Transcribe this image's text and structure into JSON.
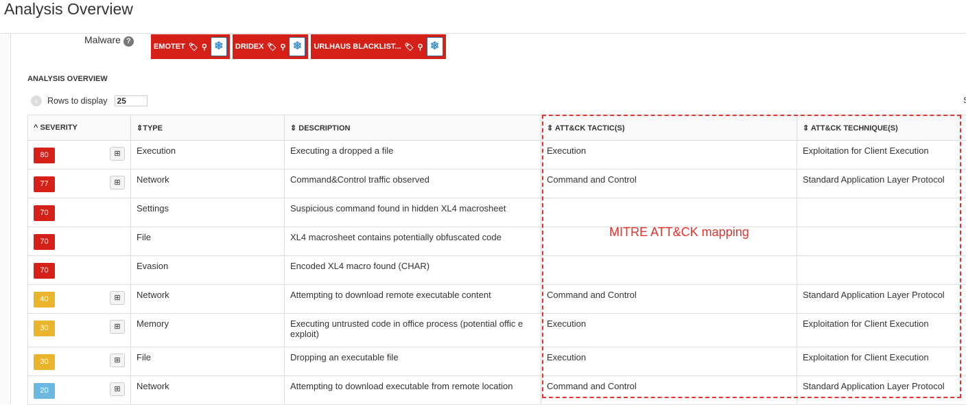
{
  "header": {
    "title": "Analysis Overview"
  },
  "malware": {
    "label": "Malware",
    "help": "?",
    "tags": [
      {
        "name": "EMOTET"
      },
      {
        "name": "DRIDEX"
      },
      {
        "name": "URLHAUS BLACKLIST..."
      }
    ]
  },
  "section_title": "ANALYSIS OVERVIEW",
  "rows_to_display": {
    "label": "Rows to display",
    "value": "25",
    "right_text": "S"
  },
  "columns": [
    "SEVERITY",
    "TYPE",
    "DESCRIPTION",
    "ATT&CK TACTIC(S)",
    "ATT&CK TECHNIQUE(S)"
  ],
  "rows": [
    {
      "score": "80",
      "color": "#d42017",
      "os": true,
      "type": "Execution",
      "desc": "Executing a dropped a file",
      "tactic": "Execution",
      "tech": "Exploitation for Client Execution"
    },
    {
      "score": "77",
      "color": "#d42017",
      "os": true,
      "type": "Network",
      "desc": "Command&Control traffic observed",
      "tactic": "Command and Control",
      "tech": "Standard Application Layer Protocol"
    },
    {
      "score": "70",
      "color": "#d42017",
      "os": false,
      "type": "Settings",
      "desc": "Suspicious command found in hidden XL4 macrosheet",
      "tactic": "",
      "tech": ""
    },
    {
      "score": "70",
      "color": "#d42017",
      "os": false,
      "type": "File",
      "desc": "XL4 macrosheet contains potentially obfuscated code",
      "tactic": "",
      "tech": ""
    },
    {
      "score": "70",
      "color": "#d42017",
      "os": false,
      "type": "Evasion",
      "desc": "Encoded XL4 macro found (CHAR)",
      "tactic": "",
      "tech": ""
    },
    {
      "score": "40",
      "color": "#eab42c",
      "os": true,
      "type": "Network",
      "desc": "Attempting to download remote executable content",
      "tactic": "Command and Control",
      "tech": "Standard Application Layer Protocol"
    },
    {
      "score": "30",
      "color": "#eab42c",
      "os": true,
      "type": "Memory",
      "desc": "Executing untrusted code in office process (potential offic e exploit)",
      "tactic": "Execution",
      "tech": "Exploitation for Client Execution"
    },
    {
      "score": "30",
      "color": "#eab42c",
      "os": true,
      "type": "File",
      "desc": "Dropping an executable file",
      "tactic": "Execution",
      "tech": "Exploitation for Client Execution"
    },
    {
      "score": "20",
      "color": "#6cb8e0",
      "os": true,
      "type": "Network",
      "desc": "Attempting to download executable from remote location",
      "tactic": "Command and Control",
      "tech": "Standard Application Layer Protocol"
    }
  ],
  "annotation": "MITRE ATT&CK mapping"
}
